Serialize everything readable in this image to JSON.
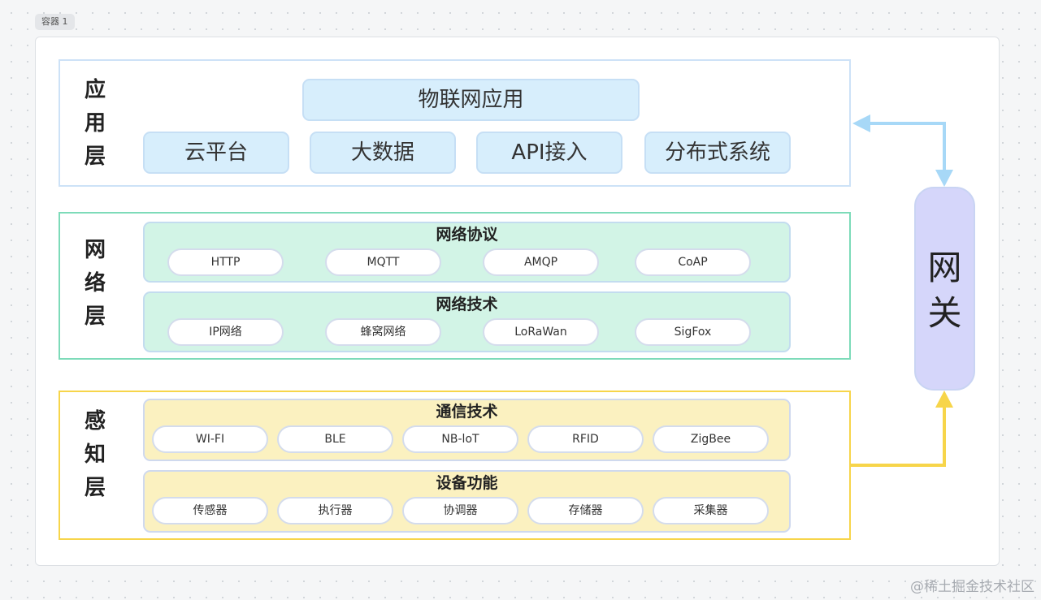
{
  "container_label": "容器 1",
  "application_layer": {
    "title": [
      "应",
      "用",
      "层"
    ],
    "top": "物联网应用",
    "items": [
      "云平台",
      "大数据",
      "API接入",
      "分布式系统"
    ]
  },
  "network_layer": {
    "title": [
      "网",
      "络",
      "层"
    ],
    "groups": [
      {
        "title": "网络协议",
        "items": [
          "HTTP",
          "MQTT",
          "AMQP",
          "CoAP"
        ]
      },
      {
        "title": "网络技术",
        "items": [
          "IP网络",
          "蜂窝网络",
          "LoRaWan",
          "SigFox"
        ]
      }
    ]
  },
  "perception_layer": {
    "title": [
      "感",
      "知",
      "层"
    ],
    "groups": [
      {
        "title": "通信技术",
        "items": [
          "WI-FI",
          "BLE",
          "NB-loT",
          "RFID",
          "ZigBee"
        ]
      },
      {
        "title": "设备功能",
        "items": [
          "传感器",
          "执行器",
          "协调器",
          "存储器",
          "采集器"
        ]
      }
    ]
  },
  "gateway": {
    "title": [
      "网",
      "关"
    ]
  },
  "watermark": "@稀土掘金技术社区",
  "colors": {
    "app_fill": "#d7eefc",
    "network_fill": "#d2f4e6",
    "perception_fill": "#fbf1c0",
    "gateway_fill": "#d5d6fa",
    "arrow_blue": "#a7d8f7",
    "arrow_yellow": "#f7d54a"
  }
}
